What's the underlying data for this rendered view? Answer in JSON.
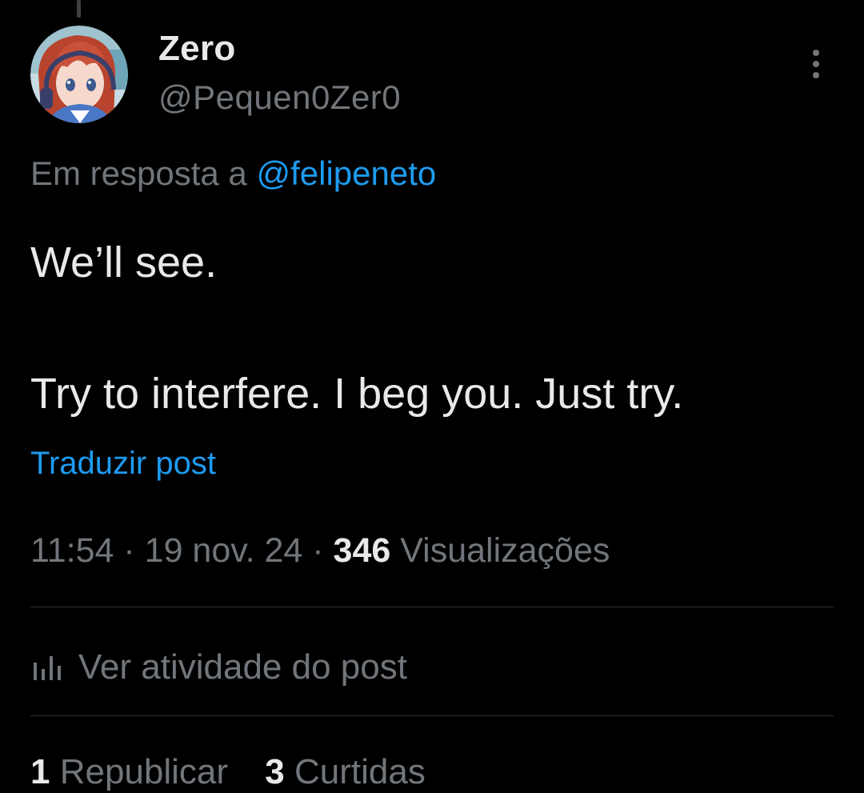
{
  "author": {
    "display_name": "Zero",
    "handle": "@Pequen0Zer0"
  },
  "reply": {
    "prefix": "Em resposta a",
    "mention": "@felipeneto"
  },
  "tweet": {
    "line1": "We’ll see.",
    "line2": "Try to interfere. I beg you. Just try."
  },
  "translate_label": "Traduzir post",
  "meta": {
    "time": "11:54",
    "date": "19 nov. 24",
    "views_count": "346",
    "views_label": "Visualizações"
  },
  "activity_label": "Ver atividade do post",
  "stats": {
    "reposts_count": "1",
    "reposts_label": "Republicar",
    "likes_count": "3",
    "likes_label": "Curtidas"
  },
  "colors": {
    "background": "#000000",
    "text_primary": "#e7e9ea",
    "text_secondary": "#71767b",
    "accent": "#1d9bf0",
    "divider": "#2f3336"
  },
  "icons": {
    "more": "more-vertical-icon",
    "activity": "bar-chart-icon"
  }
}
